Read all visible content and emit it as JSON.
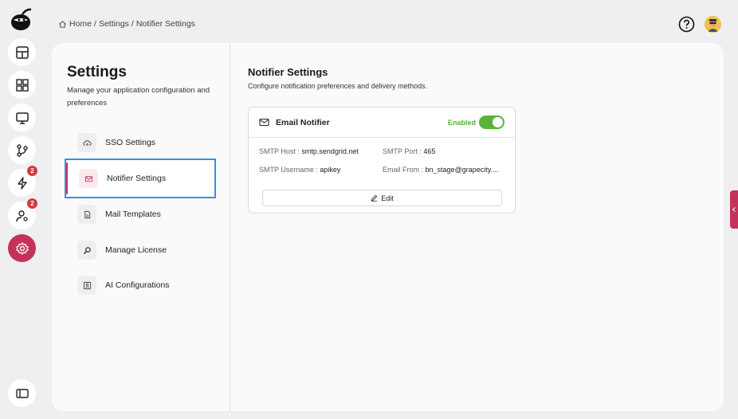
{
  "breadcrumb": {
    "home": "Home",
    "sep1": "/",
    "settings": "Settings",
    "sep2": "/",
    "current": "Notifier Settings"
  },
  "rail": {
    "badges": {
      "activity": "2",
      "users": "2"
    }
  },
  "sidebar": {
    "title": "Settings",
    "description": "Manage your application configuration and preferences",
    "items": [
      {
        "label": "SSO Settings",
        "icon": "cloud-key-icon"
      },
      {
        "label": "Notifier Settings",
        "icon": "mail-icon"
      },
      {
        "label": "Mail Templates",
        "icon": "file-icon"
      },
      {
        "label": "Manage License",
        "icon": "search-key-icon"
      },
      {
        "label": "AI Configurations",
        "icon": "ai-icon"
      }
    ]
  },
  "content": {
    "title": "Notifier Settings",
    "description": "Configure notification preferences and delivery methods."
  },
  "card": {
    "title": "Email Notifier",
    "status": "Enabled",
    "enabled": true,
    "smtp_host_label": "SMTP Host :",
    "smtp_host": "smtp.sendgrid.net",
    "smtp_port_label": "SMTP Port :",
    "smtp_port": "465",
    "smtp_username_label": "SMTP Username :",
    "smtp_username": "apikey",
    "email_from_label": "Email From :",
    "email_from": "bn_stage@grapecity....",
    "edit_label": "Edit"
  },
  "colors": {
    "accent": "#c4325a",
    "enabled": "#58b43a",
    "focus": "#3a8fe0"
  }
}
